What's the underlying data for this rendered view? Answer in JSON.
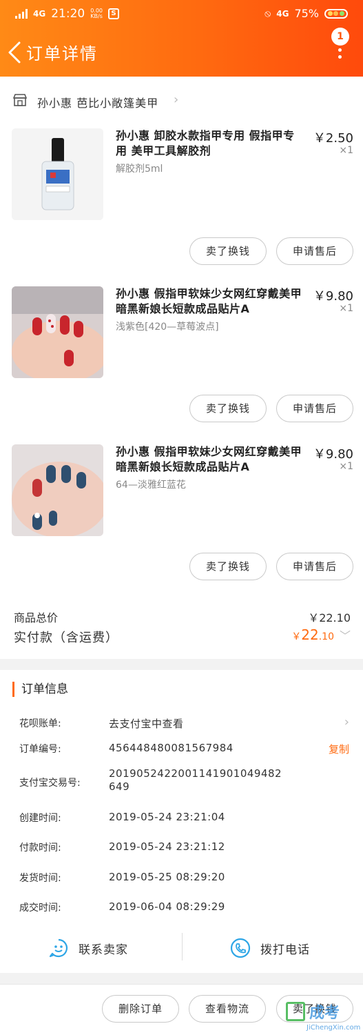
{
  "status_bar": {
    "carrier_left": "G",
    "net_left": "4G",
    "time": "21:20",
    "speed": "0.00",
    "speed_unit": "KB/s",
    "net_right": "4G",
    "battery": "75%"
  },
  "nav": {
    "title": "订单详情",
    "badge": "1"
  },
  "shop": {
    "name": "孙小惠 芭比小敞篷美甲"
  },
  "items": [
    {
      "name": "孙小惠 卸胶水款指甲专用 假指甲专用 美甲工具解胶剂",
      "sku": "解胶剂5ml",
      "price": "￥2.50",
      "qty": "×1",
      "btn_sell": "卖了换钱",
      "btn_after": "申请售后"
    },
    {
      "name": "孙小惠 假指甲软妹少女网红穿戴美甲暗黑新娘长短款成品贴片A",
      "sku": "浅紫色[420—草莓波点]",
      "price": "￥9.80",
      "qty": "×1",
      "btn_sell": "卖了换钱",
      "btn_after": "申请售后"
    },
    {
      "name": "孙小惠 假指甲软妹少女网红穿戴美甲暗黑新娘长短款成品贴片A",
      "sku": "64—淡雅红蓝花",
      "price": "￥9.80",
      "qty": "×1",
      "btn_sell": "卖了换钱",
      "btn_after": "申请售后"
    }
  ],
  "totals": {
    "goods_label": "商品总价",
    "goods_value": "￥22.10",
    "paid_label": "实付款（含运费）",
    "paid_currency": "￥",
    "paid_int": "22",
    "paid_dec": ".10"
  },
  "order_info": {
    "title": "订单信息",
    "huabei_label": "花呗账单:",
    "huabei_value": "去支付宝中查看",
    "order_no_label": "订单编号:",
    "order_no_value": "456448480081567984",
    "copy_label": "复制",
    "alipay_label": "支付宝交易号:",
    "alipay_value_line1": "2019052422001141901049482",
    "alipay_value_line2": "649",
    "created_label": "创建时间:",
    "created_value": "2019-05-24 23:21:04",
    "paid_time_label": "付款时间:",
    "paid_time_value": "2019-05-24 23:21:12",
    "ship_label": "发货时间:",
    "ship_value": "2019-05-25 08:29:20",
    "done_label": "成交时间:",
    "done_value": "2019-06-04 08:29:29"
  },
  "contact": {
    "seller": "联系卖家",
    "phone": "拨打电话"
  },
  "bottom": {
    "delete": "删除订单",
    "logistics": "查看物流",
    "sell": "卖了换钱"
  },
  "watermark": {
    "text": "成考",
    "url": "JiChengXin.com"
  },
  "colors": {
    "accent": "#ff6a10",
    "header_start": "#ff8a16",
    "header_end": "#ff4a0c"
  }
}
